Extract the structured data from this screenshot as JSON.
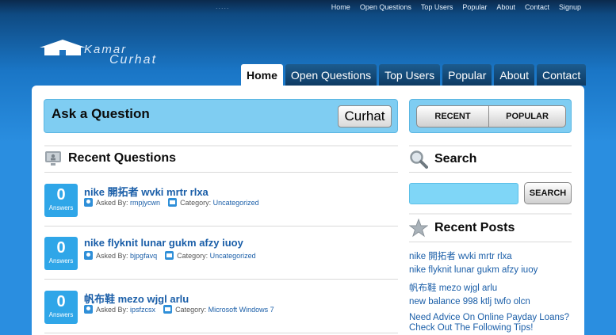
{
  "topnav": {
    "dots": ".....",
    "items": [
      "Home",
      "Open Questions",
      "Top Users",
      "Popular",
      "About",
      "Contact",
      "Signup"
    ]
  },
  "logo": {
    "line1": "Kamar",
    "line2": "Curhat"
  },
  "tabs": [
    {
      "label": "Home",
      "active": true
    },
    {
      "label": "Open Questions",
      "active": false
    },
    {
      "label": "Top Users",
      "active": false
    },
    {
      "label": "Popular",
      "active": false
    },
    {
      "label": "About",
      "active": false
    },
    {
      "label": "Contact",
      "active": false
    }
  ],
  "ask": {
    "title": "Ask a Question",
    "button": "Curhat"
  },
  "sidebar_tabs": {
    "recent": "RECENT",
    "popular": "POPULAR"
  },
  "recent_questions": {
    "heading": "Recent Questions",
    "items": [
      {
        "count": "0",
        "count_label": "Answers",
        "title": "nike 開拓者 wvki mrtr rlxa",
        "asked_by_label": "Asked By:",
        "user": "rmpjycwn",
        "category_label": "Category:",
        "category": "Uncategorized"
      },
      {
        "count": "0",
        "count_label": "Answers",
        "title": "nike flyknit lunar gukm afzy iuoy",
        "asked_by_label": "Asked By:",
        "user": "bjpgfavq",
        "category_label": "Category:",
        "category": "Uncategorized"
      },
      {
        "count": "0",
        "count_label": "Answers",
        "title": "帆布鞋 mezo wjgl arlu",
        "asked_by_label": "Asked By:",
        "user": "ipsfzcsx",
        "category_label": "Category:",
        "category": "Microsoft Windows 7"
      }
    ]
  },
  "search": {
    "heading": "Search",
    "button": "SEARCH",
    "placeholder": ""
  },
  "recent_posts": {
    "heading": "Recent Posts",
    "items": [
      "nike 開拓者 wvki mrtr rlxa",
      "nike flyknit lunar gukm afzy iuoy",
      "帆布鞋 mezo wjgl arlu",
      "new balance 998 ktlj twfo olcn",
      "Need Advice On Online Payday Loans?",
      "Check Out The Following Tips!"
    ]
  },
  "colors": {
    "accent": "#2fa6e8",
    "link": "#1a5ea8",
    "box": "#7fcdf2"
  }
}
